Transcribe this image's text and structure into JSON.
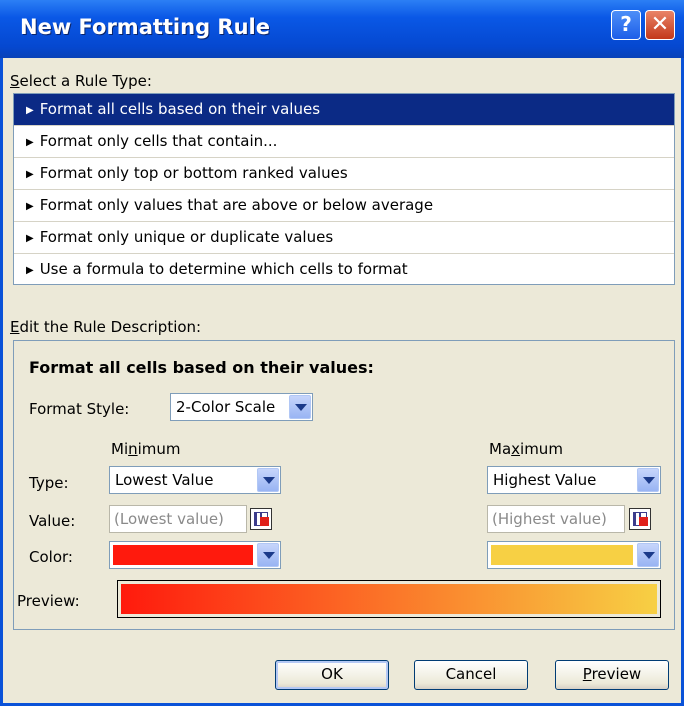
{
  "window": {
    "title": "New Formatting Rule",
    "help_glyph": "?",
    "close_glyph": "✕"
  },
  "rule_type": {
    "label": "Select a Rule Type:",
    "items": [
      {
        "label": "Format all cells based on their values",
        "selected": true
      },
      {
        "label": "Format only cells that contain...",
        "selected": false
      },
      {
        "label": "Format only top or bottom ranked values",
        "selected": false
      },
      {
        "label": "Format only values that are above or below average",
        "selected": false
      },
      {
        "label": "Format only unique or duplicate values",
        "selected": false
      },
      {
        "label": "Use a formula to determine which cells to format",
        "selected": false
      }
    ]
  },
  "description": {
    "label": "Edit the Rule Description:",
    "heading": "Format all cells based on their values:",
    "format_style_label": "Format Style:",
    "format_style_value": "2-Color Scale",
    "minimum_header": "Minimum",
    "maximum_header": "Maximum",
    "type_label": "Type:",
    "value_label": "Value:",
    "color_label": "Color:",
    "preview_label": "Preview:",
    "min_type": "Lowest Value",
    "max_type": "Highest Value",
    "min_value": "(Lowest value)",
    "max_value": "(Highest value)",
    "min_color": "#ff1a0d",
    "max_color": "#f7d044"
  },
  "buttons": {
    "ok": "OK",
    "cancel": "Cancel",
    "preview": "Preview"
  },
  "icons": {
    "rule_arrow": "triangle-right-icon",
    "dropdown": "chevron-down-icon",
    "cell_reference": "cell-reference-icon"
  }
}
